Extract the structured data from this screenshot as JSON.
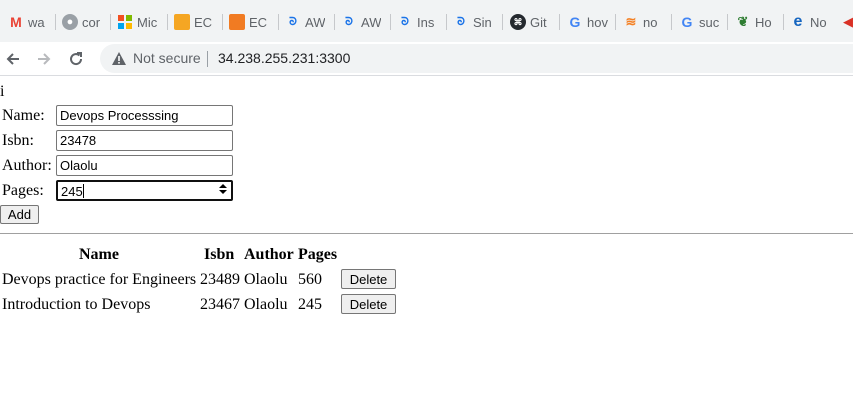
{
  "browser": {
    "bookmarks": [
      {
        "icon": "gmail-icon",
        "label": "wa"
      },
      {
        "icon": "profile-icon",
        "label": "cor"
      },
      {
        "icon": "microsoft-icon",
        "label": "Mic"
      },
      {
        "icon": "box-icon",
        "label": "EC"
      },
      {
        "icon": "box-icon",
        "label": "EC"
      },
      {
        "icon": "aws-icon",
        "label": "AW"
      },
      {
        "icon": "aws-icon",
        "label": "AW"
      },
      {
        "icon": "aws-icon",
        "label": "Ins"
      },
      {
        "icon": "aws-icon",
        "label": "Sin"
      },
      {
        "icon": "github-icon",
        "label": "Git"
      },
      {
        "icon": "google-icon",
        "label": "hov"
      },
      {
        "icon": "stackoverflow-icon",
        "label": "no"
      },
      {
        "icon": "google-icon",
        "label": "suc"
      },
      {
        "icon": "leaf-icon",
        "label": "Ho"
      },
      {
        "icon": "e-icon",
        "label": "No"
      }
    ],
    "security_label": "Not secure",
    "url": "34.238.255.231:3300"
  },
  "page": {
    "heading": "i",
    "form": {
      "name_label": "Name:",
      "name_value": "Devops Processsing",
      "isbn_label": "Isbn:",
      "isbn_value": "23478",
      "author_label": "Author:",
      "author_value": "Olaolu",
      "pages_label": "Pages:",
      "pages_value": "245",
      "add_label": "Add"
    },
    "table": {
      "headers": [
        "Name",
        "Isbn",
        "Author",
        "Pages"
      ],
      "rows": [
        {
          "name": "Devops practice for Engineers",
          "isbn": "23489",
          "author": "Olaolu",
          "pages": "560",
          "action": "Delete"
        },
        {
          "name": "Introduction to Devops",
          "isbn": "23467",
          "author": "Olaolu",
          "pages": "245",
          "action": "Delete"
        }
      ]
    }
  }
}
